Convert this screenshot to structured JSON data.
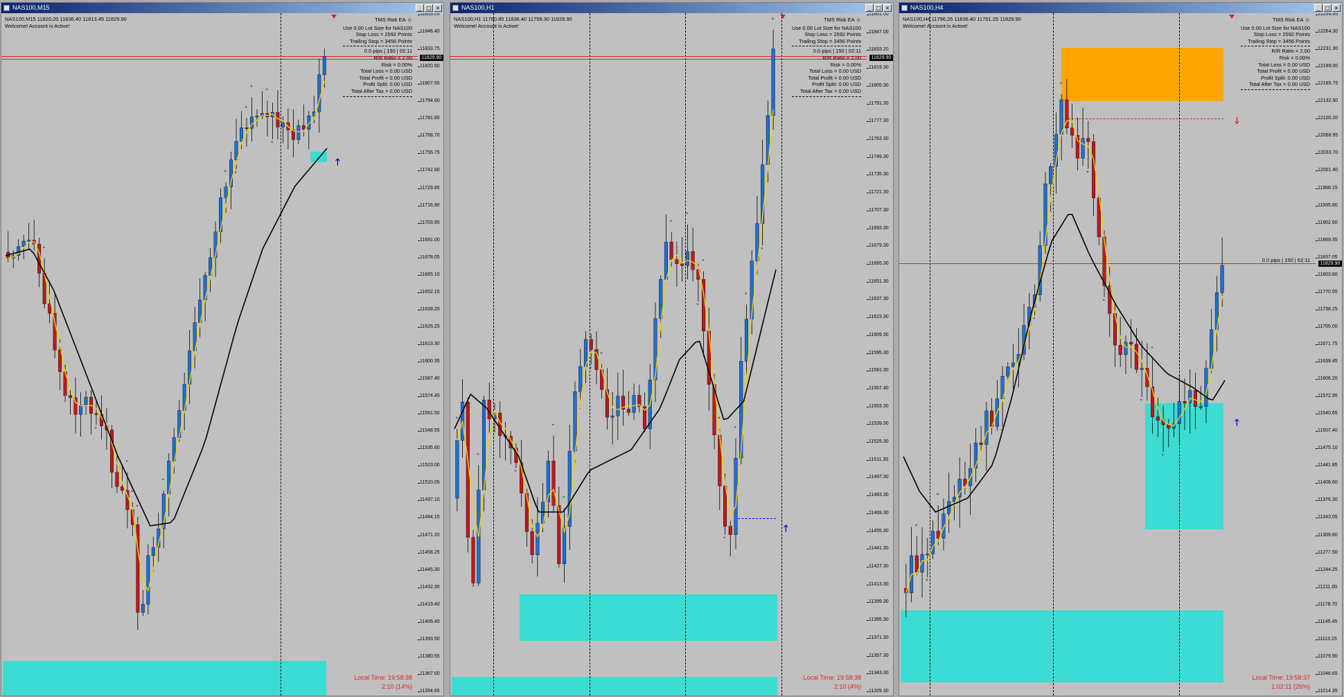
{
  "windows": [
    {
      "id": "m15",
      "title": "NAS100,M15",
      "ohlc": "NAS100,M15  11820.20 11836.40 11813.45 11829.90",
      "welcome": "Welcome! Account is Active!",
      "ea": {
        "title": "TMS Risk EA",
        "lines": [
          "Use 0.00 Lot Size for NAS100",
          "Stop Loss = 2592 Points",
          "Trailing Stop = 3456 Points"
        ],
        "pips": "0.0 pips | 150 | 02:11",
        "stats": [
          "R/R Ratio = 2.00",
          "Risk = 0.00%",
          "Total Loss = 0.00 USD",
          "Total Profit = 0.00 USD",
          "Profit Split: 0.00 USD",
          "Total After Tax = 0.00 USD"
        ]
      },
      "local_time": "Local Time: 19:58:38",
      "countdown": "2:10 (14%)",
      "price_tag": "11829.90",
      "y_ticks": [
        "11853.05",
        "11846.40",
        "11833.75",
        "11820.50",
        "11807.55",
        "11794.60",
        "11781.65",
        "11768.70",
        "11755.75",
        "11742.80",
        "11729.85",
        "11716.90",
        "11703.95",
        "11691.00",
        "11678.05",
        "11665.10",
        "11652.15",
        "11639.20",
        "11626.25",
        "11613.30",
        "11600.35",
        "11587.40",
        "11574.45",
        "11561.50",
        "11548.55",
        "11535.60",
        "11523.00",
        "11510.05",
        "11497.10",
        "11484.15",
        "11471.20",
        "11458.25",
        "11445.30",
        "11432.35",
        "11419.40",
        "11406.45",
        "11393.50",
        "11380.55",
        "11367.60",
        "11354.65"
      ],
      "price_top": 11853.05,
      "price_bottom": 11354.65
    },
    {
      "id": "h1",
      "title": "NAS100,H1",
      "ohlc": "NAS100,H1  11760.85 11836.40 11759.30 11829.90",
      "welcome": "Welcome! Account is Active!",
      "ea": {
        "title": "TMS Risk EA",
        "lines": [
          "Use 0.00 Lot Size for NAS100",
          "Stop Loss = 2592 Points",
          "Trailing Stop = 3456 Points"
        ],
        "pips": "0.0 pips | 150 | 02:11",
        "stats": [
          "R/R Ratio = 2.00",
          "Risk = 0.00%",
          "Total Loss = 0.00 USD",
          "Total Profit = 0.00 USD",
          "Profit Split: 0.00 USD",
          "Total After Tax = 0.00 USD"
        ]
      },
      "local_time": "Local Time: 19:58:38",
      "countdown": "2:10 (4%)",
      "price_tag": "11829.90",
      "y_ticks": [
        "11861.00",
        "11847.00",
        "11833.20",
        "11819.30",
        "11805.30",
        "11791.30",
        "11777.30",
        "11763.30",
        "11749.30",
        "11735.30",
        "11721.30",
        "11707.30",
        "11693.30",
        "11679.30",
        "11665.30",
        "11651.30",
        "11637.30",
        "11623.30",
        "11609.30",
        "11595.30",
        "11581.30",
        "11567.40",
        "11553.30",
        "11539.30",
        "11525.30",
        "11511.30",
        "11497.30",
        "11483.30",
        "11469.30",
        "11455.30",
        "11441.30",
        "11427.30",
        "11413.30",
        "11399.30",
        "11385.30",
        "11371.30",
        "11357.30",
        "11343.30",
        "11329.30"
      ],
      "price_top": 11861.0,
      "price_bottom": 11315.0
    },
    {
      "id": "h4",
      "title": "NAS100,H4",
      "ohlc": "NAS100,H4  11796.25 11836.40 11751.25 11829.90",
      "welcome": "Welcome! Account is Active!",
      "ea": {
        "title": "TMS Risk EA",
        "lines": [
          "Use 0.00 Lot Size for NAS100",
          "Stop Loss = 2592 Points",
          "Trailing Stop = 3456 Points"
        ],
        "pips": "",
        "stats": [
          "R/R Ratio = 2.00",
          "Risk = 0.00%",
          "Total Loss = 0.00 USD",
          "Total Profit = 0.00 USD",
          "Profit Split: 0.00 USD",
          "Total After Tax = 0.00 USD"
        ]
      },
      "pips_label": "0.0 pips | 150 | 62:11",
      "local_time": "Local Time: 19:58:37",
      "countdown": "1:02:11 (26%)",
      "price_tag": "11829.90",
      "y_ticks": [
        "12296.95",
        "12264.30",
        "12231.30",
        "12199.00",
        "12165.75",
        "12132.50",
        "12100.20",
        "12066.95",
        "12033.70",
        "12001.40",
        "11968.15",
        "11935.80",
        "11902.60",
        "11869.35",
        "11837.05",
        "11803.80",
        "11770.55",
        "11738.25",
        "11705.00",
        "11671.75",
        "11639.45",
        "11606.20",
        "11572.95",
        "11540.65",
        "11507.40",
        "11475.10",
        "11441.85",
        "11408.60",
        "11376.30",
        "11343.05",
        "11309.80",
        "11277.50",
        "11244.25",
        "11211.00",
        "11178.70",
        "11145.45",
        "11113.15",
        "11079.90",
        "11046.65",
        "11014.35"
      ],
      "price_top": 12296.95,
      "price_bottom": 11014.35
    }
  ],
  "colors": {
    "bull": "#1f6fd0",
    "bear": "#c01818",
    "fast_ma": "#f5d000",
    "slow_ma": "#000000",
    "zone": "#3ddcd3",
    "supply": "#ffa500",
    "price_line": "#e02020"
  }
}
